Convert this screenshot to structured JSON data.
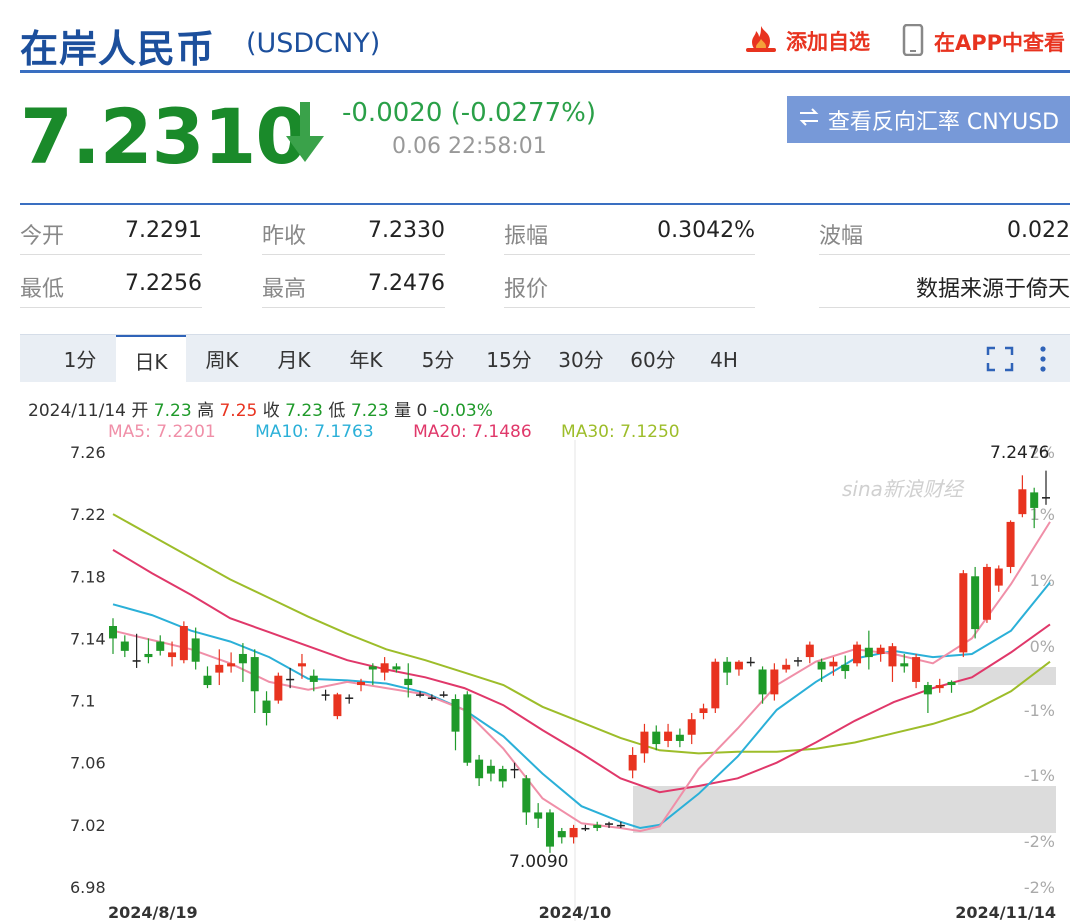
{
  "header": {
    "title": "在岸人民币",
    "code": "(USDCNY)",
    "add_watch": "添加自选",
    "view_app": "在APP中查看"
  },
  "quote": {
    "price": "7.2310",
    "change": "-0.0020 (-0.0277%)",
    "time": "0.06 22:58:01",
    "reverse_label": "查看反向汇率 CNYUSD"
  },
  "stats": [
    {
      "label": "今开",
      "value": "7.2291"
    },
    {
      "label": "昨收",
      "value": "7.2330"
    },
    {
      "label": "振幅",
      "value": "0.3042%"
    },
    {
      "label": "波幅",
      "value": "0.022"
    },
    {
      "label": "最低",
      "value": "7.2256"
    },
    {
      "label": "最高",
      "value": "7.2476"
    },
    {
      "label": "报价",
      "value": ""
    },
    {
      "label": "",
      "value": "数据来源于倚天"
    }
  ],
  "tabs": [
    "1分",
    "日K",
    "周K",
    "月K",
    "年K",
    "5分",
    "15分",
    "30分",
    "60分",
    "4H"
  ],
  "active_tab": "日K",
  "ohlc": {
    "date": "2024/11/14",
    "open_label": "开",
    "open": "7.23",
    "high_label": "高",
    "high": "7.25",
    "close_label": "收",
    "close": "7.23",
    "low_label": "低",
    "low": "7.23",
    "vol_label": "量",
    "vol": "0",
    "pct": "-0.03%"
  },
  "ma": {
    "ma5": "MA5: 7.2201",
    "ma10": "MA10: 7.1763",
    "ma20": "MA20: 7.1486",
    "ma30": "MA30: 7.1250"
  },
  "watermark": "sina新浪财经",
  "colors": {
    "up": "#e8331f",
    "down": "#1f9a2a",
    "ma5": "#f08fa8",
    "ma10": "#2bb0d8",
    "ma20": "#e0386a",
    "ma30": "#9dbd2a"
  },
  "chart_data": {
    "type": "candlestick",
    "y_ticks": [
      "7.26",
      "7.22",
      "7.18",
      "7.14",
      "7.1",
      "7.06",
      "7.02",
      "6.98"
    ],
    "pct_ticks": [
      "2%",
      "1%",
      "1%",
      "0%",
      "-1%",
      "-1%",
      "-2%",
      "-2%"
    ],
    "x_labels": [
      "2024/8/19",
      "2024/10",
      "2024/11/14"
    ],
    "max_label": "7.2476",
    "min_label": "7.0090",
    "ylim": [
      6.975,
      7.265
    ],
    "candles": [
      [
        7.148,
        7.14,
        7.153,
        7.13
      ],
      [
        7.138,
        7.132,
        7.142,
        7.128
      ],
      [
        7.126,
        7.125,
        7.143,
        7.121
      ],
      [
        7.13,
        7.128,
        7.14,
        7.124
      ],
      [
        7.138,
        7.132,
        7.142,
        7.129
      ],
      [
        7.128,
        7.131,
        7.138,
        7.122
      ],
      [
        7.126,
        7.148,
        7.151,
        7.124
      ],
      [
        7.14,
        7.125,
        7.147,
        7.12
      ],
      [
        7.116,
        7.11,
        7.122,
        7.108
      ],
      [
        7.118,
        7.123,
        7.133,
        7.11
      ],
      [
        7.122,
        7.124,
        7.131,
        7.118
      ],
      [
        7.13,
        7.124,
        7.137,
        7.112
      ],
      [
        7.128,
        7.106,
        7.133,
        7.092
      ],
      [
        7.1,
        7.092,
        7.106,
        7.084
      ],
      [
        7.1,
        7.116,
        7.118,
        7.098
      ],
      [
        7.114,
        7.114,
        7.121,
        7.108
      ],
      [
        7.122,
        7.124,
        7.13,
        7.114
      ],
      [
        7.116,
        7.112,
        7.12,
        7.106
      ],
      [
        7.104,
        7.104,
        7.107,
        7.1
      ],
      [
        7.09,
        7.104,
        7.105,
        7.088
      ],
      [
        7.102,
        7.102,
        7.104,
        7.098
      ],
      [
        7.11,
        7.112,
        7.114,
        7.106
      ],
      [
        7.122,
        7.12,
        7.124,
        7.11
      ],
      [
        7.118,
        7.124,
        7.128,
        7.113
      ],
      [
        7.122,
        7.12,
        7.124,
        7.118
      ],
      [
        7.114,
        7.11,
        7.124,
        7.102
      ],
      [
        7.104,
        7.104,
        7.106,
        7.102
      ],
      [
        7.102,
        7.102,
        7.104,
        7.1
      ],
      [
        7.104,
        7.104,
        7.106,
        7.102
      ],
      [
        7.101,
        7.08,
        7.104,
        7.068
      ],
      [
        7.104,
        7.06,
        7.106,
        7.058
      ],
      [
        7.062,
        7.05,
        7.065,
        7.045
      ],
      [
        7.058,
        7.053,
        7.062,
        7.048
      ],
      [
        7.056,
        7.048,
        7.058,
        7.044
      ],
      [
        7.056,
        7.056,
        7.06,
        7.05
      ],
      [
        7.05,
        7.028,
        7.052,
        7.02
      ],
      [
        7.028,
        7.024,
        7.034,
        7.018
      ],
      [
        7.028,
        7.006,
        7.03,
        7.002
      ],
      [
        7.016,
        7.012,
        7.018,
        7.008
      ],
      [
        7.012,
        7.018,
        7.02,
        7.008
      ],
      [
        7.018,
        7.018,
        7.02,
        7.016
      ],
      [
        7.02,
        7.018,
        7.022,
        7.016
      ],
      [
        7.02,
        7.021,
        7.022,
        7.018
      ],
      [
        7.02,
        7.02,
        7.022,
        7.018
      ],
      [
        7.055,
        7.065,
        7.07,
        7.05
      ],
      [
        7.066,
        7.08,
        7.085,
        7.06
      ],
      [
        7.08,
        7.072,
        7.084,
        7.068
      ],
      [
        7.074,
        7.08,
        7.085,
        7.07
      ],
      [
        7.078,
        7.074,
        7.082,
        7.07
      ],
      [
        7.078,
        7.088,
        7.092,
        7.072
      ],
      [
        7.092,
        7.095,
        7.098,
        7.088
      ],
      [
        7.095,
        7.125,
        7.127,
        7.092
      ],
      [
        7.125,
        7.118,
        7.128,
        7.11
      ],
      [
        7.12,
        7.125,
        7.126,
        7.116
      ],
      [
        7.125,
        7.125,
        7.128,
        7.122
      ],
      [
        7.12,
        7.104,
        7.122,
        7.098
      ],
      [
        7.104,
        7.12,
        7.124,
        7.1
      ],
      [
        7.12,
        7.123,
        7.127,
        7.118
      ],
      [
        7.126,
        7.126,
        7.128,
        7.122
      ],
      [
        7.128,
        7.136,
        7.138,
        7.124
      ],
      [
        7.125,
        7.12,
        7.127,
        7.112
      ],
      [
        7.122,
        7.125,
        7.128,
        7.116
      ],
      [
        7.123,
        7.119,
        7.129,
        7.114
      ],
      [
        7.124,
        7.136,
        7.138,
        7.122
      ],
      [
        7.134,
        7.128,
        7.145,
        7.12
      ],
      [
        7.13,
        7.134,
        7.136,
        7.125
      ],
      [
        7.122,
        7.135,
        7.137,
        7.112
      ],
      [
        7.124,
        7.122,
        7.13,
        7.118
      ],
      [
        7.112,
        7.128,
        7.13,
        7.108
      ],
      [
        7.11,
        7.104,
        7.112,
        7.092
      ],
      [
        7.108,
        7.11,
        7.114,
        7.105
      ],
      [
        7.112,
        7.11,
        7.113,
        7.105
      ],
      [
        7.131,
        7.182,
        7.184,
        7.128
      ],
      [
        7.18,
        7.146,
        7.186,
        7.14
      ],
      [
        7.152,
        7.186,
        7.188,
        7.15
      ],
      [
        7.174,
        7.185,
        7.187,
        7.17
      ],
      [
        7.186,
        7.215,
        7.216,
        7.182
      ],
      [
        7.22,
        7.236,
        7.245,
        7.218
      ],
      [
        7.234,
        7.224,
        7.237,
        7.211
      ],
      [
        7.23,
        7.231,
        7.248,
        7.226
      ]
    ],
    "ma5": [
      [
        0,
        7.145
      ],
      [
        0.1,
        7.139
      ],
      [
        0.2,
        7.133
      ],
      [
        0.3,
        7.124
      ],
      [
        0.4,
        7.112
      ],
      [
        0.5,
        7.107
      ],
      [
        0.6,
        7.112
      ],
      [
        0.7,
        7.108
      ],
      [
        0.8,
        7.104
      ],
      [
        0.9,
        7.094
      ],
      [
        1.0,
        7.069
      ],
      [
        1.1,
        7.037
      ],
      [
        1.2,
        7.021
      ],
      [
        1.3,
        7.018
      ],
      [
        1.35,
        7.016
      ],
      [
        1.4,
        7.019
      ],
      [
        1.5,
        7.056
      ],
      [
        1.6,
        7.082
      ],
      [
        1.7,
        7.11
      ],
      [
        1.8,
        7.125
      ],
      [
        1.9,
        7.133
      ],
      [
        2.0,
        7.13
      ],
      [
        2.1,
        7.124
      ],
      [
        2.2,
        7.14
      ],
      [
        2.3,
        7.175
      ],
      [
        2.4,
        7.215
      ]
    ],
    "ma10": [
      [
        0,
        7.162
      ],
      [
        0.1,
        7.155
      ],
      [
        0.2,
        7.145
      ],
      [
        0.3,
        7.138
      ],
      [
        0.4,
        7.128
      ],
      [
        0.5,
        7.114
      ],
      [
        0.6,
        7.113
      ],
      [
        0.7,
        7.111
      ],
      [
        0.8,
        7.105
      ],
      [
        0.9,
        7.094
      ],
      [
        1.0,
        7.077
      ],
      [
        1.1,
        7.053
      ],
      [
        1.2,
        7.032
      ],
      [
        1.3,
        7.022
      ],
      [
        1.35,
        7.018
      ],
      [
        1.4,
        7.02
      ],
      [
        1.5,
        7.04
      ],
      [
        1.6,
        7.064
      ],
      [
        1.7,
        7.094
      ],
      [
        1.8,
        7.112
      ],
      [
        1.9,
        7.127
      ],
      [
        2.0,
        7.132
      ],
      [
        2.1,
        7.128
      ],
      [
        2.2,
        7.13
      ],
      [
        2.3,
        7.145
      ],
      [
        2.4,
        7.176
      ]
    ],
    "ma20": [
      [
        0,
        7.197
      ],
      [
        0.1,
        7.182
      ],
      [
        0.2,
        7.168
      ],
      [
        0.3,
        7.153
      ],
      [
        0.4,
        7.144
      ],
      [
        0.5,
        7.135
      ],
      [
        0.6,
        7.126
      ],
      [
        0.7,
        7.12
      ],
      [
        0.8,
        7.115
      ],
      [
        0.9,
        7.108
      ],
      [
        1.0,
        7.097
      ],
      [
        1.1,
        7.081
      ],
      [
        1.2,
        7.066
      ],
      [
        1.3,
        7.05
      ],
      [
        1.4,
        7.041
      ],
      [
        1.5,
        7.045
      ],
      [
        1.6,
        7.05
      ],
      [
        1.7,
        7.06
      ],
      [
        1.8,
        7.073
      ],
      [
        1.9,
        7.087
      ],
      [
        2.0,
        7.099
      ],
      [
        2.1,
        7.108
      ],
      [
        2.2,
        7.115
      ],
      [
        2.3,
        7.131
      ],
      [
        2.4,
        7.149
      ]
    ],
    "ma30": [
      [
        0,
        7.22
      ],
      [
        0.1,
        7.206
      ],
      [
        0.2,
        7.192
      ],
      [
        0.3,
        7.178
      ],
      [
        0.4,
        7.166
      ],
      [
        0.5,
        7.154
      ],
      [
        0.6,
        7.143
      ],
      [
        0.7,
        7.133
      ],
      [
        0.8,
        7.126
      ],
      [
        0.9,
        7.118
      ],
      [
        1.0,
        7.11
      ],
      [
        1.1,
        7.096
      ],
      [
        1.2,
        7.086
      ],
      [
        1.3,
        7.076
      ],
      [
        1.4,
        7.068
      ],
      [
        1.5,
        7.066
      ],
      [
        1.6,
        7.067
      ],
      [
        1.7,
        7.067
      ],
      [
        1.8,
        7.069
      ],
      [
        1.9,
        7.073
      ],
      [
        2.0,
        7.079
      ],
      [
        2.1,
        7.085
      ],
      [
        2.2,
        7.093
      ],
      [
        2.3,
        7.106
      ],
      [
        2.4,
        7.125
      ]
    ]
  }
}
